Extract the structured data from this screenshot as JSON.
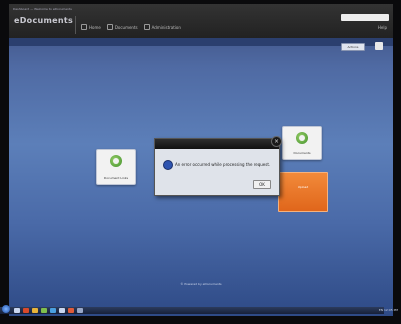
{
  "app": {
    "brand": "eDocuments",
    "top_small_text": "Dashboard  —  Welcome to eDocuments",
    "module_labels": [
      "Home",
      "Documents",
      "Administration"
    ],
    "top_right_label": "Help"
  },
  "subbar": {
    "button_label": "Actions"
  },
  "tiles": {
    "left": {
      "label": "Document Links"
    },
    "right": {
      "label": "Documents"
    },
    "orange": {
      "label": "Upload"
    }
  },
  "dialog": {
    "message": "An error occurred while processing the request.",
    "ok_label": "OK",
    "close_glyph": "×"
  },
  "footer": {
    "text": "© Powered by eDocuments"
  },
  "taskbar": {
    "tray_text": "EN  12:05 PM"
  },
  "colors": {
    "accent_orange": "#e87225",
    "topbar": "#2a2a2a",
    "desktop_blue": "#4f6fae"
  }
}
